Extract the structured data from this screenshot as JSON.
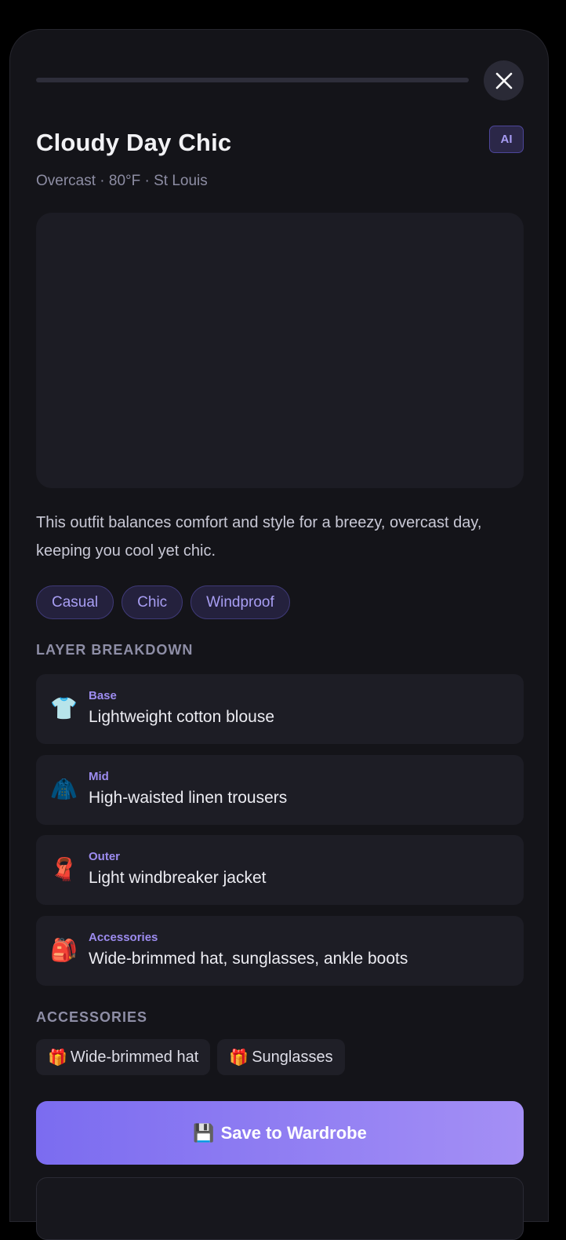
{
  "header": {
    "title": "Cloudy Day Chic",
    "ai_badge": "AI",
    "subtitle": "Overcast · 80°F · St Louis"
  },
  "description": "This outfit balances comfort and style for a breezy, overcast day, keeping you cool yet chic.",
  "tags": [
    "Casual",
    "Chic",
    "Windproof"
  ],
  "layer_breakdown": {
    "heading": "LAYER BREAKDOWN",
    "items": [
      {
        "icon": "👕",
        "icon_name": "shirt-icon",
        "category": "Base",
        "text": "Lightweight cotton blouse"
      },
      {
        "icon": "🧥",
        "icon_name": "coat-icon",
        "category": "Mid",
        "text": "High-waisted linen trousers"
      },
      {
        "icon": "🧣",
        "icon_name": "scarf-icon",
        "category": "Outer",
        "text": "Light windbreaker jacket"
      },
      {
        "icon": "🎒",
        "icon_name": "backpack-icon",
        "category": "Accessories",
        "text": "Wide-brimmed hat, sunglasses, ankle boots"
      }
    ]
  },
  "accessories": {
    "heading": "ACCESSORIES",
    "items": [
      {
        "icon": "🎁",
        "label": "Wide-brimmed hat"
      },
      {
        "icon": "🎁",
        "label": "Sunglasses"
      }
    ]
  },
  "save_button": {
    "icon": "💾",
    "label": "Save to Wardrobe"
  },
  "colors": {
    "accent": "#8b7cf2",
    "background": "#141419",
    "card": "#1d1d25"
  }
}
